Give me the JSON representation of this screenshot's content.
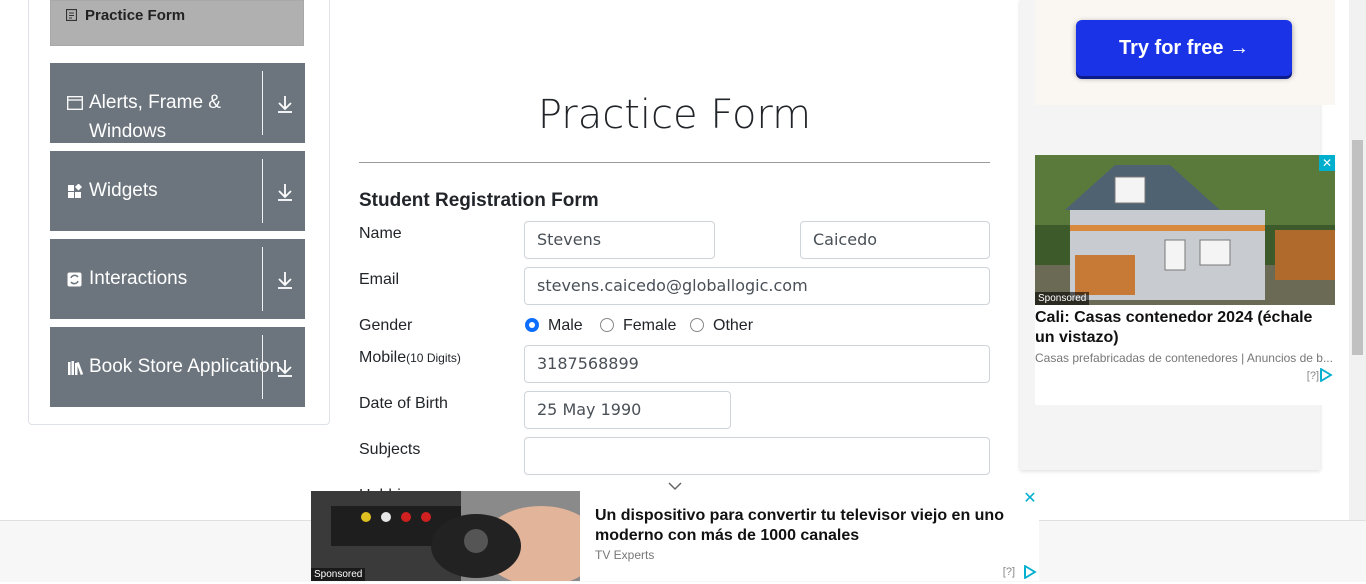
{
  "sidebar": {
    "active_item": "Practice Form",
    "groups": [
      {
        "label": "Alerts, Frame & Windows",
        "icon": "window-icon"
      },
      {
        "label": "Widgets",
        "icon": "widgets-icon"
      },
      {
        "label": "Interactions",
        "icon": "interactions-icon"
      },
      {
        "label": "Book Store Application",
        "icon": "books-icon"
      }
    ]
  },
  "form": {
    "page_title": "Practice Form",
    "heading": "Student Registration Form",
    "name_label": "Name",
    "first_name": "Stevens",
    "last_name": "Caicedo",
    "email_label": "Email",
    "email": "stevens.caicedo@globallogic.com",
    "gender_label": "Gender",
    "gender_options": [
      "Male",
      "Female",
      "Other"
    ],
    "gender_selected": "Male",
    "mobile_label": "Mobile",
    "mobile_hint": "(10 Digits)",
    "mobile": "3187568899",
    "dob_label": "Date of Birth",
    "dob": "25 May 1990",
    "subjects_label": "Subjects",
    "subjects": "",
    "hobbies_label": "Hobbies"
  },
  "ads": {
    "top_button": "Try for free →",
    "card": {
      "sponsored": "Sponsored",
      "title": "Cali: Casas contenedor 2024 (échale un vistazo)",
      "subtitle": "Casas prefabricadas de contenedores | Anuncios de b...",
      "info": "[?]"
    },
    "bottom": {
      "sponsored": "Sponsored",
      "title": "Un dispositivo para convertir tu televisor viejo en uno moderno con más de 1000 canales",
      "subtitle": "TV Experts",
      "info": "[?]"
    },
    "close_symbol": "✕"
  },
  "colors": {
    "sidebar_group_bg": "#6c757d",
    "sidebar_active_bg": "#b0b0b0",
    "radio_checked": "#0d6efd",
    "ad_button_bg": "#1b33e6",
    "ad_accent": "#00aecd"
  }
}
